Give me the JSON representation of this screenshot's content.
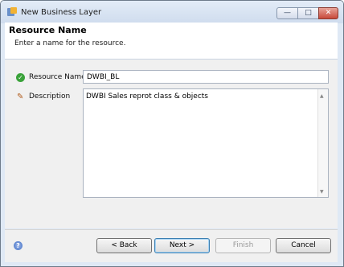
{
  "window": {
    "title": "New Business Layer",
    "controls": {
      "minimize": "—",
      "maximize": "□",
      "close": "✕"
    }
  },
  "header": {
    "title": "Resource Name",
    "subtitle": "Enter a name for the resource."
  },
  "form": {
    "resource_name_label": "Resource Name",
    "resource_name_value": "DWBI_BL",
    "description_label": "Description",
    "description_value": "DWBI Sales reprot class & objects"
  },
  "icons": {
    "status": "check-circle-icon",
    "description": "pencil-icon",
    "help": "help-icon"
  },
  "buttons": {
    "back": "< Back",
    "next": "Next >",
    "finish": "Finish",
    "cancel": "Cancel"
  }
}
